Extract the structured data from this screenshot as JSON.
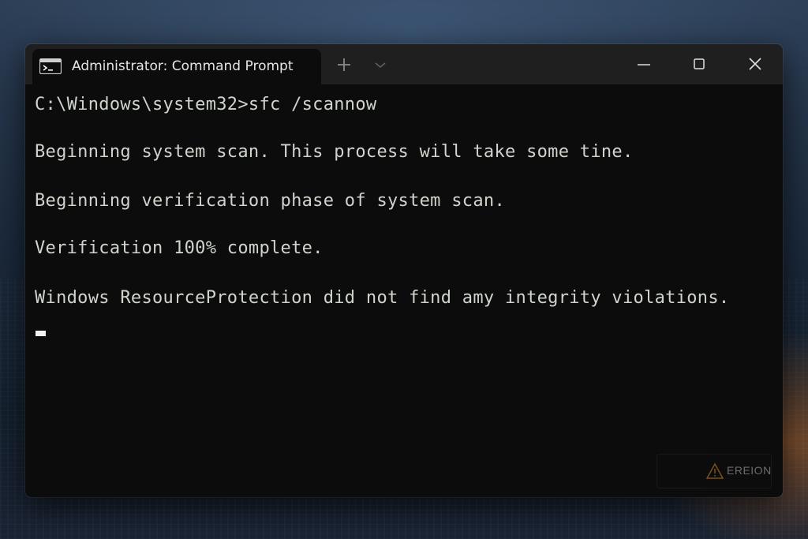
{
  "window": {
    "tab_title": "Administrator: Command Prompt",
    "tab_icon": "terminal-icon",
    "new_tab_icon": "plus-icon",
    "dropdown_icon": "chevron-down-icon",
    "minimize_icon": "minimize-icon",
    "maximize_icon": "maximize-icon",
    "close_icon": "close-icon"
  },
  "console": {
    "lines": [
      "C:\\Windows\\system32>sfc /scannow",
      "Beginning system scan. This process will take some tine.",
      "Beginning verification phase of system scan.",
      "Verification 100% complete.",
      "Windows ResourceProtection did not find amy integrity violations."
    ]
  },
  "watermark": {
    "text": "EREION",
    "icon": "warning-icon"
  },
  "colors": {
    "console_bg": "#0c0c0c",
    "console_text": "#cfd5cc",
    "titlebar_bg": "#1f1f1f"
  }
}
